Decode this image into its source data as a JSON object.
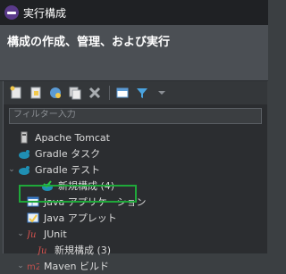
{
  "window": {
    "title": "実行構成",
    "icon": "eclipse-icon"
  },
  "header": {
    "title": "構成の作成、管理、および実行"
  },
  "toolbar": {
    "buttons": [
      {
        "name": "new-configuration-icon"
      },
      {
        "name": "new-prototype-icon"
      },
      {
        "name": "export-icon"
      },
      {
        "name": "duplicate-icon"
      },
      {
        "name": "delete-icon"
      },
      {
        "name": "collapse-all-icon"
      },
      {
        "name": "filter-icon"
      },
      {
        "name": "view-menu-icon"
      }
    ]
  },
  "filter": {
    "placeholder": "フィルター入力"
  },
  "tree": {
    "items": [
      {
        "label": "Apache Tomcat",
        "icon": "tomcat-icon",
        "expandable": false,
        "indent": 0
      },
      {
        "label": "Gradle タスク",
        "icon": "gradle-icon",
        "expandable": false,
        "indent": 0
      },
      {
        "label": "Gradle テスト",
        "icon": "gradle-icon",
        "expandable": true,
        "expanded": true,
        "indent": 0
      },
      {
        "label": "新規構成 (4)",
        "icon": "gradle-test-config-icon",
        "expandable": false,
        "indent": 1
      },
      {
        "label": "Java アプリケーション",
        "icon": "java-application-icon",
        "expandable": false,
        "indent": 0,
        "highlighted": true
      },
      {
        "label": "Java アプレット",
        "icon": "java-applet-icon",
        "expandable": false,
        "indent": 0
      },
      {
        "label": "JUnit",
        "icon": "junit-icon",
        "expandable": true,
        "expanded": true,
        "indent": 0
      },
      {
        "label": "新規構成 (3)",
        "icon": "junit-config-icon",
        "expandable": false,
        "indent": 1
      },
      {
        "label": "Maven ビルド",
        "icon": "maven-icon",
        "expandable": true,
        "expanded": true,
        "indent": 0
      }
    ]
  },
  "colors": {
    "highlight_border": "#1fa83a",
    "title_bar": "#1f2124",
    "header_bg": "#4b4f54",
    "panel_bg": "#2b2d30"
  }
}
